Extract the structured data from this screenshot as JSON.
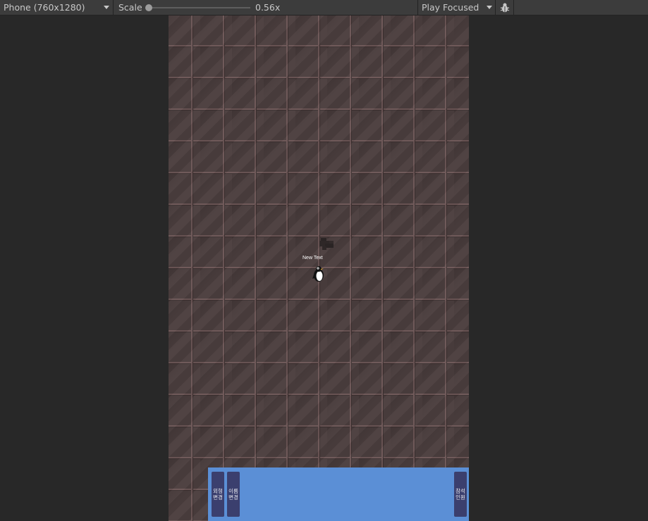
{
  "toolbar": {
    "resolution": "Phone (760x1280)",
    "scale_label": "Scale",
    "scale_value": "0.56x",
    "scale_fraction": 0.0,
    "play_mode": "Play Focused",
    "debug_icon": "bug-icon"
  },
  "game": {
    "player_label": "New Text",
    "buttons": {
      "appearance": "외형\n변경",
      "name": "이름\n변경",
      "attendees": "참석\n인원"
    }
  },
  "colors": {
    "panel": "#5b8fd6",
    "button": "#3b3f6e",
    "tile": "#4a3d3d"
  }
}
